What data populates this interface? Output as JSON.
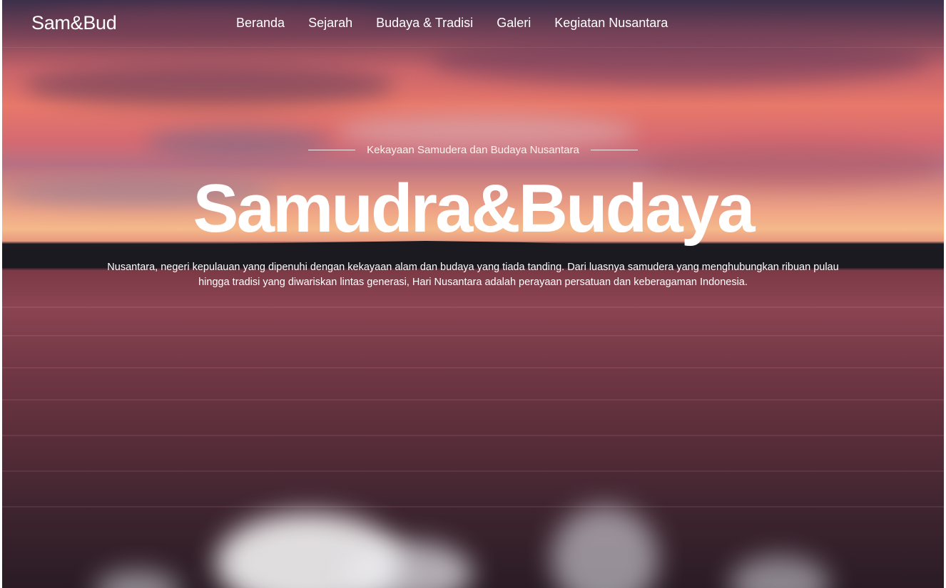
{
  "brand": "Sam&Bud",
  "nav": {
    "items": [
      "Beranda",
      "Sejarah",
      "Budaya & Tradisi",
      "Galeri",
      "Kegiatan Nusantara"
    ]
  },
  "hero": {
    "eyebrow": "Kekayaan Samudera dan Budaya Nusantara",
    "title": "Samudra&Budaya",
    "description": "Nusantara, negeri kepulauan yang dipenuhi dengan kekayaan alam dan budaya yang tiada tanding. Dari luasnya samudera yang menghubungkan ribuan pulau hingga tradisi yang diwariskan lintas generasi, Hari Nusantara adalah perayaan persatuan dan keberagaman Indonesia.",
    "background": "sunset-over-sea"
  },
  "colors": {
    "text": "#ffffff",
    "sky_top": "#3c2f4a",
    "sunset": "#e8786a",
    "water": "#733846"
  }
}
